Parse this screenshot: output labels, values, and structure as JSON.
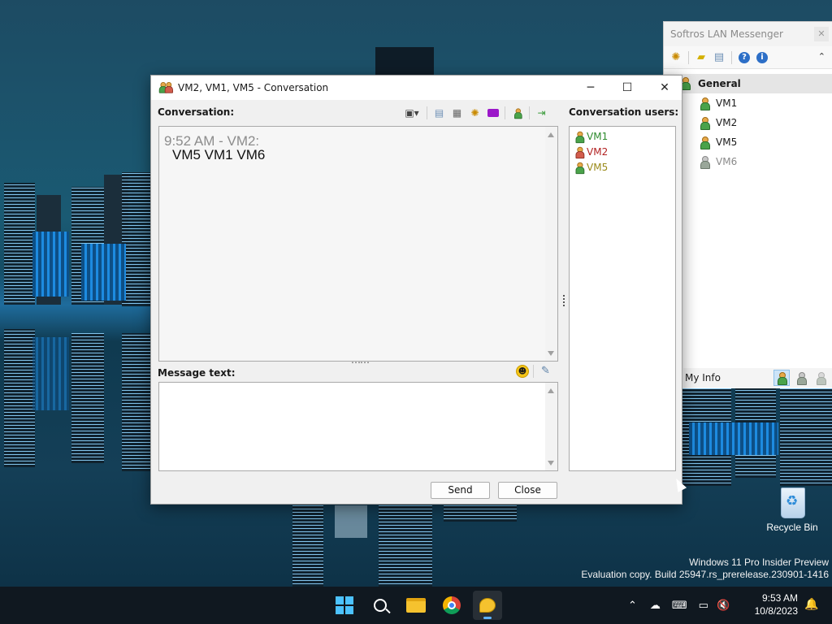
{
  "desktop": {
    "recycle_bin_label": "Recycle Bin",
    "watermark_line1": "Windows 11 Pro Insider Preview",
    "watermark_line2": "Evaluation copy. Build 25947.rs_prerelease.230901-1416"
  },
  "messenger": {
    "title": "Softros LAN Messenger",
    "group": "General",
    "users": [
      {
        "name": "VM1",
        "status": "online"
      },
      {
        "name": "VM2",
        "status": "online"
      },
      {
        "name": "VM5",
        "status": "online"
      },
      {
        "name": "VM6",
        "status": "offline"
      }
    ],
    "footer_label": "My Info"
  },
  "conversation": {
    "window_title": "VM2, VM1, VM5 - Conversation",
    "conversation_label": "Conversation:",
    "users_label": "Conversation users:",
    "message_text_label": "Message text:",
    "messages": [
      {
        "header": "9:52 AM - VM2:",
        "body": "VM5 VM1 VM6"
      }
    ],
    "message_input_value": "",
    "participants": [
      {
        "name": "VM1",
        "color": "#2e8b2e"
      },
      {
        "name": "VM2",
        "color": "#b22222"
      },
      {
        "name": "VM5",
        "color": "#9a8a1a"
      }
    ],
    "send_label": "Send",
    "close_label": "Close"
  },
  "taskbar": {
    "apps": [
      "start-icon",
      "search-icon",
      "file-explorer-icon",
      "chrome-icon",
      "softros-messenger-icon"
    ],
    "clock_time": "9:53 AM",
    "clock_date": "10/8/2023"
  },
  "colors": {
    "accent": "#4cc2ff",
    "taskbar_bg": "#101820"
  }
}
